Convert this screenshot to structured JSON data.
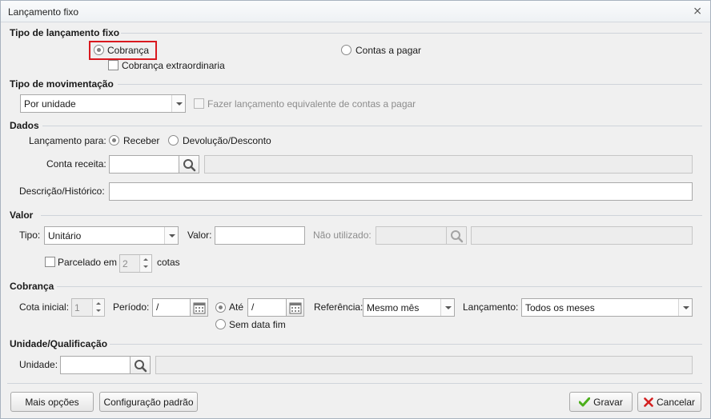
{
  "window": {
    "title": "Lançamento fixo",
    "close_glyph": "⨯"
  },
  "tipo_lancamento": {
    "title": "Tipo de lançamento fixo",
    "cobranca_label": "Cobrança",
    "cobranca_checked": true,
    "extra_label": "Cobrança extraordinaria",
    "contas_pagar_label": "Contas a pagar"
  },
  "tipo_movimentacao": {
    "title": "Tipo de movimentação",
    "select_value": "Por unidade",
    "equivalente_label": "Fazer lançamento equivalente de contas a pagar"
  },
  "dados": {
    "title": "Dados",
    "lancamento_para_label": "Lançamento para:",
    "receber_label": "Receber",
    "devolucao_label": "Devolução/Desconto",
    "conta_receita_label": "Conta receita:",
    "conta_receita_value": "",
    "conta_receita_desc": "",
    "descricao_label": "Descrição/Histórico:",
    "descricao_value": ""
  },
  "valor": {
    "title": "Valor",
    "tipo_label": "Tipo:",
    "tipo_value": "Unitário",
    "valor_label": "Valor:",
    "valor_value": "",
    "nao_utilizado_label": "Não utilizado:",
    "parcelado_label": "Parcelado em",
    "parcelas_value": "2",
    "cotas_label": "cotas"
  },
  "cobranca": {
    "title": "Cobrança",
    "cota_inicial_label": "Cota inicial:",
    "cota_inicial_value": "1",
    "periodo_label": "Período:",
    "periodo_value": " /",
    "ate_label": "Até",
    "ate_value": " /",
    "sem_data_fim_label": "Sem data fim",
    "referencia_label": "Referência:",
    "referencia_value": "Mesmo mês",
    "lancamento_label": "Lançamento:",
    "lancamento_value": "Todos os meses"
  },
  "unidade": {
    "title": "Unidade/Qualificação",
    "unidade_label": "Unidade:",
    "unidade_value": ""
  },
  "footer": {
    "mais_opcoes": "Mais opções",
    "config_padrao": "Configuração padrão",
    "gravar": "Gravar",
    "cancelar": "Cancelar"
  },
  "colors": {
    "highlight": "#d9191f",
    "check_green": "#4caf1c",
    "cancel_red": "#d32020"
  }
}
